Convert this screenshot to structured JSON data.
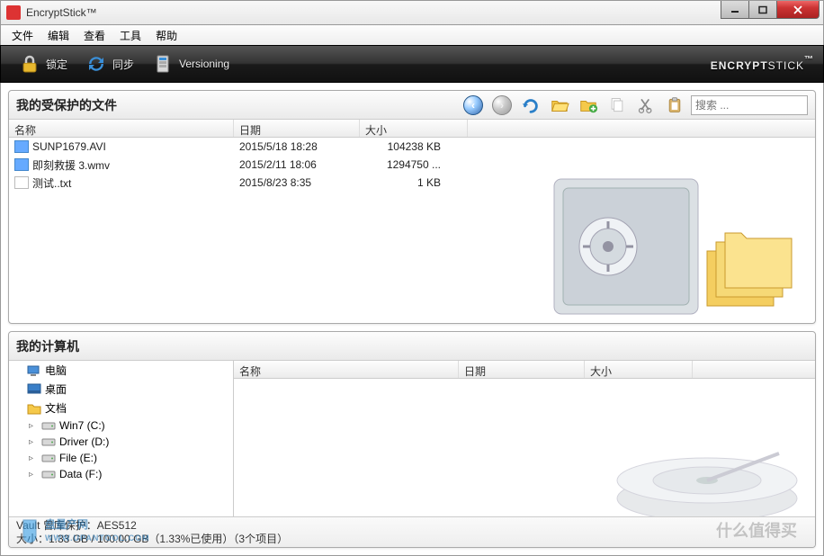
{
  "window": {
    "title": "EncryptStick™"
  },
  "menu": {
    "file": "文件",
    "edit": "编辑",
    "view": "查看",
    "tools": "工具",
    "help": "帮助"
  },
  "toolbar": {
    "lock": "锁定",
    "sync": "同步",
    "versioning": "Versioning",
    "brand": "ENCRYPT",
    "brand2": "STICK"
  },
  "protected": {
    "title": "我的受保护的文件",
    "search_placeholder": "搜索 ...",
    "cols": {
      "name": "名称",
      "date": "日期",
      "size": "大小"
    },
    "files": [
      {
        "name": "SUNP1679.AVI",
        "date": "2015/5/18 18:28",
        "size": "104238 KB",
        "type": "video"
      },
      {
        "name": "即刻救援 3.wmv",
        "date": "2015/2/11 18:06",
        "size": "1294750 ...",
        "type": "video"
      },
      {
        "name": "测试..txt",
        "date": "2015/8/23 8:35",
        "size": "1 KB",
        "type": "txt"
      }
    ]
  },
  "computer": {
    "title": "我的计算机",
    "cols": {
      "name": "名称",
      "date": "日期",
      "size": "大小"
    },
    "tree": [
      {
        "label": "电脑",
        "icon": "pc",
        "indent": false
      },
      {
        "label": "桌面",
        "icon": "desktop",
        "indent": false
      },
      {
        "label": "文档",
        "icon": "folder",
        "indent": false
      },
      {
        "label": "Win7 (C:)",
        "icon": "drive",
        "indent": true,
        "caret": true
      },
      {
        "label": "Driver (D:)",
        "icon": "drive",
        "indent": true,
        "caret": true
      },
      {
        "label": "File (E:)",
        "icon": "drive",
        "indent": true,
        "caret": true
      },
      {
        "label": "Data (F:)",
        "icon": "drive",
        "indent": true,
        "caret": true
      }
    ]
  },
  "status": {
    "line1": "Vault 曾库保护：AES512",
    "line2": "大小：1.33 GB / 100.00 GB（1.33%已使用）（3个项目）"
  },
  "watermark": {
    "left_main": "盘量产网",
    "left_sub": "WWW.UPANTOOL.COM",
    "right": "什么值得买"
  }
}
